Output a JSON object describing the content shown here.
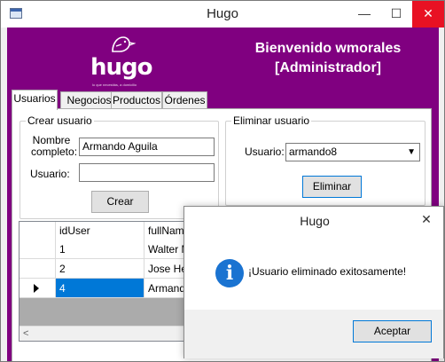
{
  "window": {
    "title": "Hugo",
    "minimize_glyph": "—",
    "maximize_glyph": "☐",
    "close_glyph": "✕"
  },
  "banner": {
    "brand": "hugo",
    "tagline": "lo que necesitás, a domicilio",
    "welcome_line1": "Bienvenido wmorales",
    "welcome_line2": "[Administrador]",
    "color": "#800080"
  },
  "tabs": [
    {
      "label": "Usuarios"
    },
    {
      "label": "Negocios"
    },
    {
      "label": "Productos"
    },
    {
      "label": "Órdenes"
    }
  ],
  "create_user": {
    "legend": "Crear usuario",
    "fullname_label_line1": "Nombre",
    "fullname_label_line2": "completo:",
    "fullname_value": "Armando Aguila",
    "username_label": "Usuario:",
    "username_value": "",
    "button_label": "Crear"
  },
  "delete_user": {
    "legend": "Eliminar usuario",
    "username_label": "Usuario:",
    "selected_user": "armando8",
    "button_label": "Eliminar"
  },
  "grid": {
    "columns": [
      "idUser",
      "fullName"
    ],
    "rows": [
      {
        "idUser": "1",
        "fullName": "Walter M"
      },
      {
        "idUser": "2",
        "fullName": "Jose Her"
      },
      {
        "idUser": "4",
        "fullName": "Armando"
      }
    ],
    "scroll_left_glyph": "<"
  },
  "dialog": {
    "title": "Hugo",
    "close_glyph": "✕",
    "icon": "info-icon",
    "icon_glyph": "i",
    "message": "¡Usuario eliminado exitosamente!",
    "ok_label": "Aceptar"
  }
}
